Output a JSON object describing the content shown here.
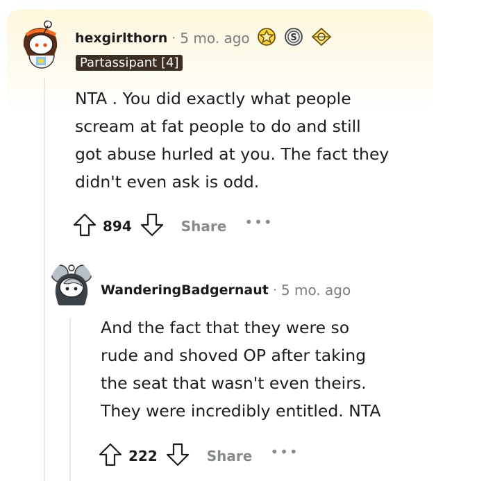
{
  "comment": {
    "username": "hexgirlthorn",
    "separator": "·",
    "time": "5 mo. ago",
    "flair": "Partassipant [4]",
    "body": [
      "NTA . You did exactly what people",
      "scream at fat people to do and still",
      "got abuse hurled at you. The fact they",
      "didn't even ask is odd."
    ],
    "votes": "894",
    "share_label": "Share",
    "more_label": "•••",
    "awards": [
      "star-award-icon",
      "silver-award-icon",
      "helpful-award-icon"
    ]
  },
  "reply": {
    "username": "WanderingBadgernaut",
    "separator": "·",
    "time": "5 mo. ago",
    "body": [
      "And the fact that they were so",
      "rude and shoved OP after taking",
      "the seat that wasn't even theirs.",
      "They were incredibly entitled. NTA"
    ],
    "votes": "222",
    "share_label": "Share",
    "more_label": "•••"
  },
  "colors": {
    "highlight": "#fdf7dc",
    "flair_bg": "#3e2f25",
    "meta_text": "#7c7c7c",
    "share_text": "#878a8c"
  }
}
